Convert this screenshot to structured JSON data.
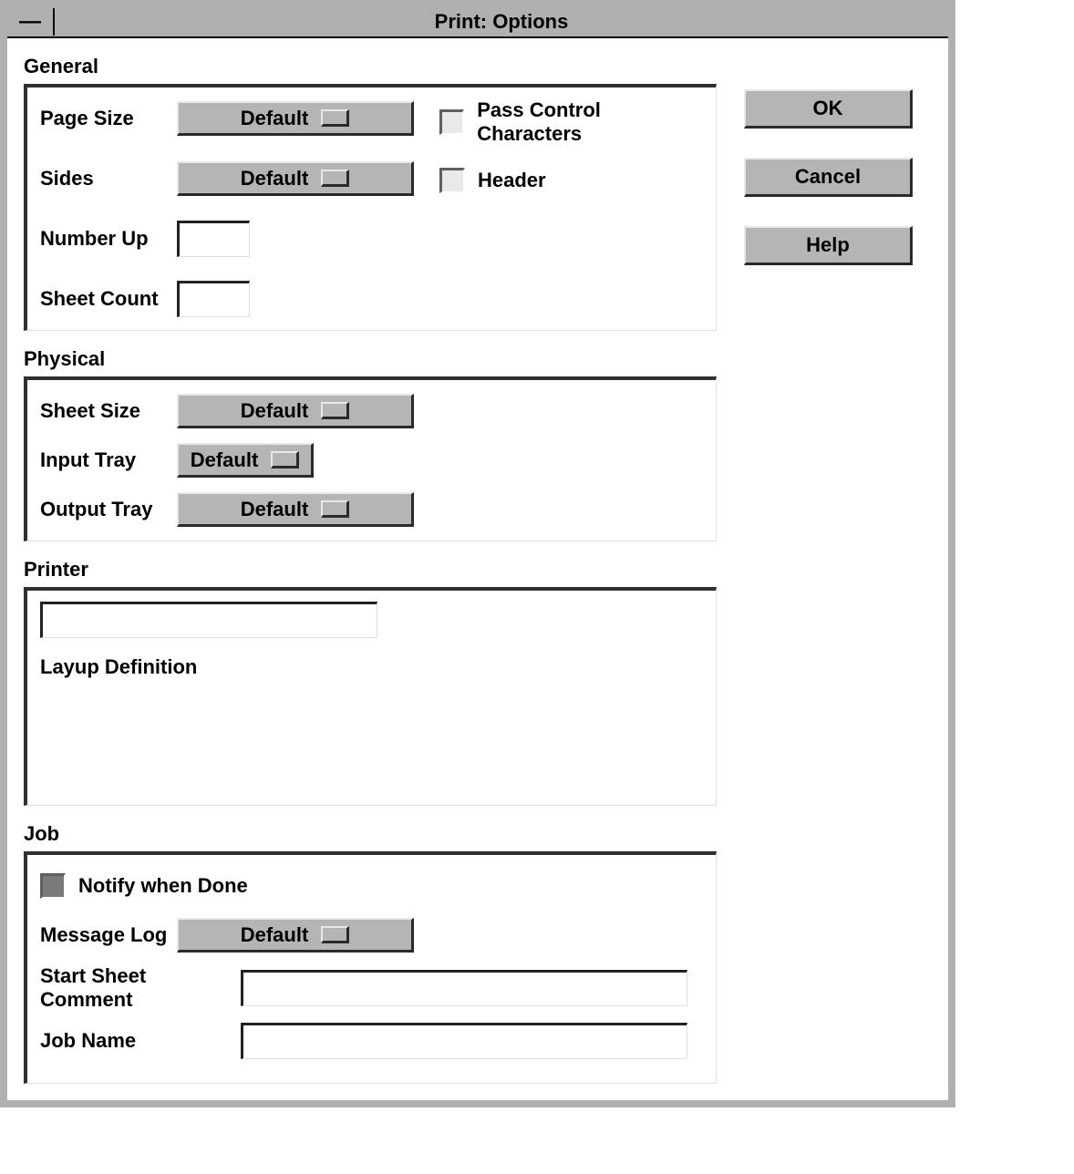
{
  "window": {
    "title": "Print: Options",
    "sysmenu_glyph": "—"
  },
  "sections": {
    "general": {
      "title": "General",
      "page_size_label": "Page Size",
      "page_size_value": "Default",
      "sides_label": "Sides",
      "sides_value": "Default",
      "number_up_label": "Number Up",
      "number_up_value": "",
      "sheet_count_label": "Sheet Count",
      "sheet_count_value": "",
      "pass_control_chars_label": "Pass Control Characters",
      "header_label": "Header"
    },
    "physical": {
      "title": "Physical",
      "sheet_size_label": "Sheet Size",
      "sheet_size_value": "Default",
      "input_tray_label": "Input Tray",
      "input_tray_value": "Default",
      "output_tray_label": "Output Tray",
      "output_tray_value": "Default"
    },
    "printer": {
      "title": "Printer",
      "layup_definition_label": "Layup Definition",
      "layup_definition_value": ""
    },
    "job": {
      "title": "Job",
      "notify_label": "Notify when Done",
      "message_log_label": "Message Log",
      "message_log_value": "Default",
      "start_sheet_comment_label": "Start Sheet Comment",
      "start_sheet_comment_value": "",
      "job_name_label": "Job Name",
      "job_name_value": ""
    }
  },
  "buttons": {
    "ok": "OK",
    "cancel": "Cancel",
    "help": "Help"
  }
}
